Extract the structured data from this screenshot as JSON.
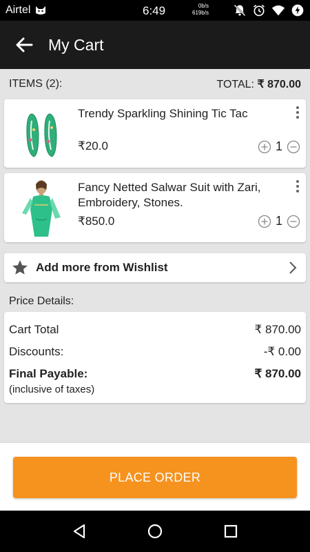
{
  "status_bar": {
    "carrier": "Airtel",
    "time": "6:49",
    "speed_up": "0b/s",
    "speed_down": "619b/s"
  },
  "app_bar": {
    "title": "My Cart",
    "back_icon": "arrow-left-icon"
  },
  "summary": {
    "items_label": "ITEMS (2):",
    "total_label": "TOTAL:",
    "total_value": "₹ 870.00"
  },
  "cart_items": [
    {
      "name": "Trendy Sparkling Shining Tic Tac",
      "price": "₹20.0",
      "quantity": "1"
    },
    {
      "name": "Fancy Netted Salwar Suit with Zari, Embroidery, Stones.",
      "price": "₹850.0",
      "quantity": "1"
    }
  ],
  "wishlist": {
    "label": "Add more from Wishlist",
    "icon": "star-icon"
  },
  "price_details": {
    "title": "Price Details:",
    "cart_total_label": "Cart Total",
    "cart_total_value": "₹ 870.00",
    "discounts_label": "Discounts:",
    "discounts_value": "-₹ 0.00",
    "final_label": "Final Payable:",
    "final_value": "₹ 870.00",
    "tax_note": "(inclusive of taxes)"
  },
  "place_order": {
    "label": "PLACE ORDER"
  },
  "colors": {
    "accent": "#f6921e",
    "app_bar": "#1b1b1b",
    "background": "#e4e4e4"
  }
}
